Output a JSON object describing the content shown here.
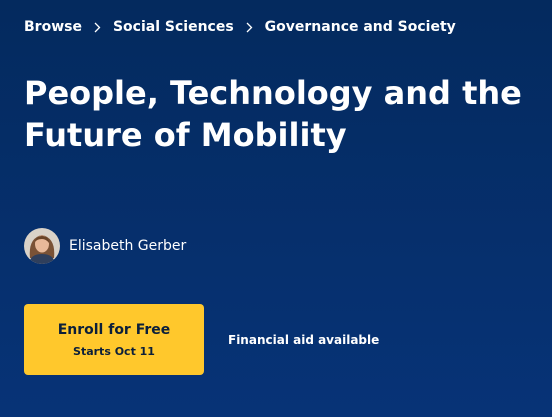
{
  "breadcrumb": {
    "items": [
      {
        "label": "Browse"
      },
      {
        "label": "Social Sciences"
      },
      {
        "label": "Governance and Society"
      }
    ]
  },
  "course": {
    "title": "People, Technology and the Future of Mobility"
  },
  "instructor": {
    "name": "Elisabeth Gerber",
    "avatar_icon": "person-avatar"
  },
  "enroll": {
    "label": "Enroll for Free",
    "sublabel": "Starts Oct 11"
  },
  "financial_aid": {
    "label": "Financial aid available"
  },
  "colors": {
    "background": "#042a5e",
    "accent": "#ffc82c",
    "text": "#ffffff"
  }
}
